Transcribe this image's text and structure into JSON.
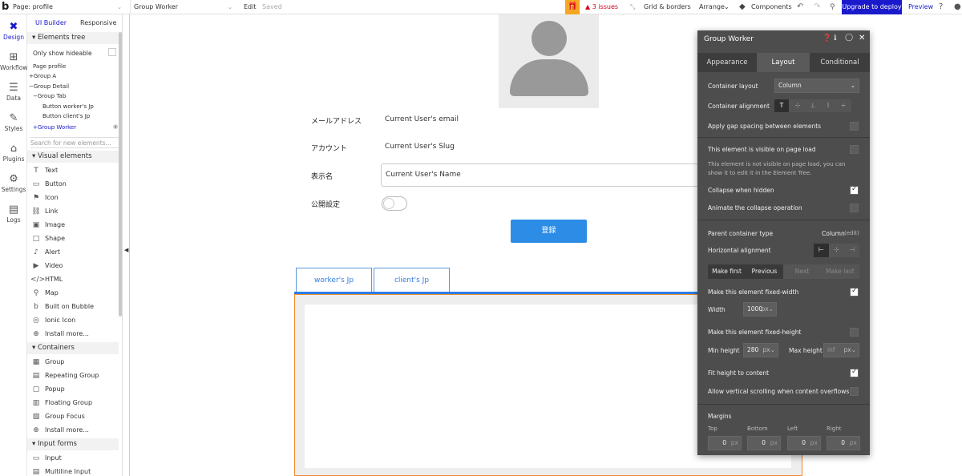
{
  "topbar": {
    "page_label": "Page: profile",
    "element_select": "Group Worker",
    "edit": "Edit",
    "saved": "Saved",
    "issues": "3 issues",
    "grid_borders": "Grid & borders",
    "arrange": "Arrange",
    "components": "Components",
    "deploy": "Upgrade to deploy",
    "preview": "Preview"
  },
  "rail": [
    {
      "label": "Design",
      "icon": "design-icon"
    },
    {
      "label": "Workflow",
      "icon": "workflow-icon"
    },
    {
      "label": "Data",
      "icon": "data-icon"
    },
    {
      "label": "Styles",
      "icon": "styles-icon"
    },
    {
      "label": "Plugins",
      "icon": "plugins-icon"
    },
    {
      "label": "Settings",
      "icon": "gear-icon"
    },
    {
      "label": "Logs",
      "icon": "logs-icon"
    }
  ],
  "panel": {
    "tab_ui": "UI Builder",
    "tab_resp": "Responsive",
    "elements_tree": "Elements tree",
    "only_show_hideable": "Only show hideable",
    "tree": [
      "Page profile",
      "Group A",
      "Group Detail",
      "Group Tab",
      "Button worker's Jp",
      "Button client's Jp",
      "Group Worker"
    ],
    "search_placeholder": "Search for new elements...",
    "visual_elements": "Visual elements",
    "visual": [
      "Text",
      "Button",
      "Icon",
      "Link",
      "Image",
      "Shape",
      "Alert",
      "Video",
      "HTML",
      "Map",
      "Built on Bubble",
      "Ionic Icon",
      "Install more..."
    ],
    "containers": "Containers",
    "container_items": [
      "Group",
      "Repeating Group",
      "Popup",
      "Floating Group",
      "Group Focus",
      "Install more..."
    ],
    "input_forms": "Input forms",
    "input_items": [
      "Input",
      "Multiline Input"
    ]
  },
  "canvas": {
    "email_label": "メールアドレス",
    "email_value": "Current User's email",
    "account_label": "アカウント",
    "account_value": "Current User's Slug",
    "name_label": "表示名",
    "name_value": "Current User's Name",
    "public_label": "公開設定",
    "register": "登録",
    "tab1": "worker's Jp",
    "tab2": "client's Jp"
  },
  "prop": {
    "title": "Group Worker",
    "tabs": [
      "Appearance",
      "Layout",
      "Conditional"
    ],
    "container_layout": "Container layout",
    "container_layout_value": "Column",
    "container_alignment": "Container alignment",
    "gap_spacing": "Apply gap spacing between elements",
    "visible_on_load": "This element is visible on page load",
    "not_visible_note": "This element is not visible on page load, you can show it to edit it in the Element Tree.",
    "collapse_hidden": "Collapse when hidden",
    "animate_collapse": "Animate the collapse operation",
    "parent_type": "Parent container type",
    "parent_type_value": "Column",
    "parent_type_edit": "(edit)",
    "horizontal_alignment": "Horizontal alignment",
    "make_first": "Make first",
    "previous": "Previous",
    "next": "Next",
    "make_last": "Make last",
    "fixed_width": "Make this element fixed-width",
    "width": "Width",
    "width_value": "1000",
    "px": "px",
    "fixed_height": "Make this element fixed-height",
    "min_height": "Min height",
    "min_height_value": "280",
    "max_height": "Max height",
    "max_height_value": "inf",
    "fit_height": "Fit height to content",
    "allow_scroll": "Allow vertical scrolling when content overflows",
    "margins": "Margins",
    "top": "Top",
    "bottom": "Bottom",
    "left": "Left",
    "right": "Right",
    "zero": "0"
  },
  "colors": {
    "accent": "#1a1acc",
    "button": "#2d8ce6",
    "panel": "#4d4d4d",
    "selection": "#f08a2c"
  }
}
